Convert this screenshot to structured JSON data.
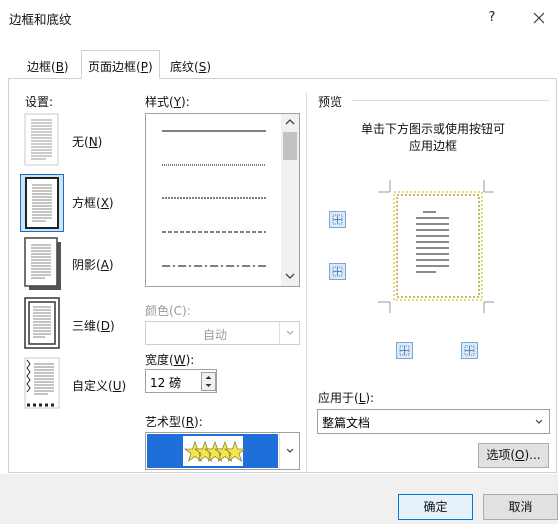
{
  "window": {
    "title": "边框和底纹",
    "help_label": "?"
  },
  "tabs": [
    {
      "label": "边框(",
      "key": "B",
      "suffix": ")"
    },
    {
      "label": "页面边框(",
      "key": "P",
      "suffix": ")"
    },
    {
      "label": "底纹(",
      "key": "S",
      "suffix": ")"
    }
  ],
  "settings": {
    "label": "设置:",
    "items": [
      {
        "label": "无(",
        "key": "N",
        "suffix": ")"
      },
      {
        "label": "方框(",
        "key": "X",
        "suffix": ")"
      },
      {
        "label": "阴影(",
        "key": "A",
        "suffix": ")"
      },
      {
        "label": "三维(",
        "key": "D",
        "suffix": ")"
      },
      {
        "label": "自定义(",
        "key": "U",
        "suffix": ")"
      }
    ],
    "selected_index": 1
  },
  "style": {
    "label": "样式(",
    "key": "Y",
    "suffix": "):"
  },
  "color": {
    "label": "颜色(C):",
    "value": "自动"
  },
  "width": {
    "label": "宽度(",
    "key": "W",
    "suffix": "):",
    "value": "12 磅"
  },
  "art": {
    "label": "艺术型(",
    "key": "R",
    "suffix": "):"
  },
  "preview": {
    "label": "预览",
    "hint_line1": "单击下方图示或使用按钮可",
    "hint_line2": "应用边框"
  },
  "apply_to": {
    "label": "应用于(",
    "key": "L",
    "suffix": "):",
    "value": "整篇文档"
  },
  "options_button": {
    "label": "选项(",
    "key": "O",
    "suffix": ")..."
  },
  "ok_button": "确定",
  "cancel_button": "取消",
  "colors": {
    "accent": "#0078d7",
    "art_blue": "#1e6fd9",
    "star_yellow": "#f4e64a"
  }
}
